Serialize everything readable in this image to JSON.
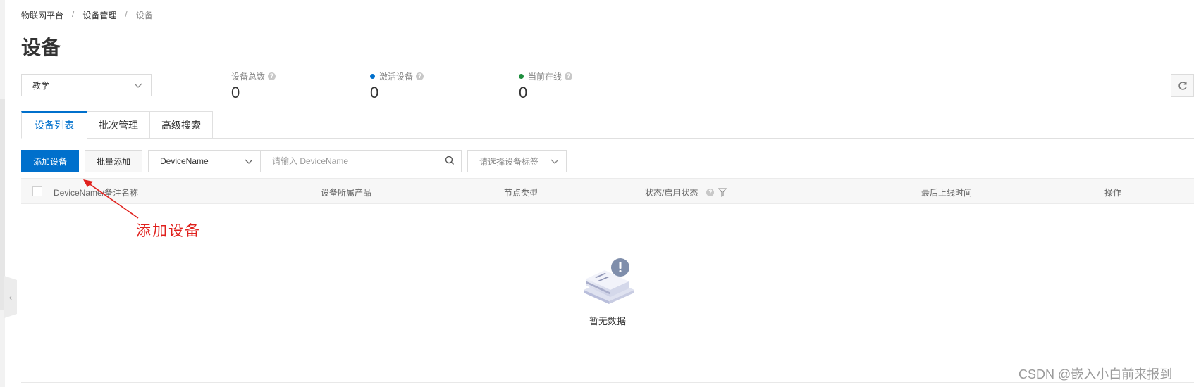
{
  "breadcrumb": [
    {
      "label": "物联网平台"
    },
    {
      "label": "设备管理"
    },
    {
      "label": "设备"
    }
  ],
  "breadcrumb_separator": "/",
  "page_title": "设备",
  "product_select": {
    "value": "教学",
    "icon": "chevron-down-icon"
  },
  "stats": [
    {
      "label": "设备总数",
      "value": "0",
      "dot_color": null,
      "help_icon": "question-circle-icon"
    },
    {
      "label": "激活设备",
      "value": "0",
      "dot_color": "#0070cc",
      "help_icon": "question-circle-icon"
    },
    {
      "label": "当前在线",
      "value": "0",
      "dot_color": "#1e8e3e",
      "help_icon": "question-circle-icon"
    }
  ],
  "refresh_button": {
    "icon": "refresh-icon"
  },
  "tabs": [
    {
      "label": "设备列表",
      "active": true
    },
    {
      "label": "批次管理",
      "active": false
    },
    {
      "label": "高级搜索",
      "active": false
    }
  ],
  "toolbar": {
    "add_device_label": "添加设备",
    "batch_add_label": "批量添加",
    "search_field_value": "DeviceName",
    "search_placeholder": "请输入 DeviceName",
    "tag_select_placeholder": "请选择设备标签"
  },
  "table": {
    "columns": [
      {
        "label": "DeviceName/备注名称"
      },
      {
        "label": "设备所属产品"
      },
      {
        "label": "节点类型"
      },
      {
        "label": "状态/启用状态"
      },
      {
        "label": "最后上线时间"
      },
      {
        "label": "操作"
      }
    ],
    "rows": [],
    "empty_text": "暂无数据"
  },
  "annotation": {
    "text": "添加设备",
    "color": "#e0201c"
  },
  "watermark": "CSDN @嵌入小白前来报到",
  "colors": {
    "primary": "#0070cc",
    "active_dot": "#0070cc",
    "online_dot": "#1e8e3e"
  }
}
